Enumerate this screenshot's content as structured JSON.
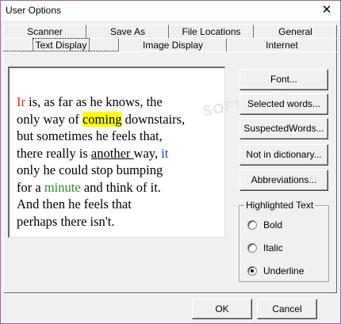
{
  "window": {
    "title": "User Options",
    "close_glyph": "✕"
  },
  "tabs": {
    "back_row": [
      "Scanner",
      "Save As",
      "File Locations",
      "General"
    ],
    "front_row": [
      "Text Display",
      "Image Display",
      "Internet"
    ],
    "active": "Text Display"
  },
  "preview": {
    "lines": [
      [
        {
          "t": "Ir",
          "style": "red"
        },
        {
          "t": " is, as far as he knows, the"
        }
      ],
      [
        {
          "t": "only way of "
        },
        {
          "t": "coming",
          "style": "hl"
        },
        {
          "t": " downstairs,"
        }
      ],
      [
        {
          "t": "but sometimes he feels that,"
        }
      ],
      [
        {
          "t": "there really is "
        },
        {
          "t": "another ",
          "style": "ul"
        },
        {
          "t": "way, "
        },
        {
          "t": "it",
          "style": "blue"
        }
      ],
      [
        {
          "t": "only he could stop bumping"
        }
      ],
      [
        {
          "t": "for a "
        },
        {
          "t": "minute",
          "style": "green"
        },
        {
          "t": " and think of it."
        }
      ],
      [
        {
          "t": "And then he feels that"
        }
      ],
      [
        {
          "t": "perhaps there isn't."
        }
      ]
    ],
    "watermark": "SOFTPEDIA"
  },
  "buttons": {
    "font": "Font...",
    "selected_words": "Selected words...",
    "suspected_words": "SuspectedWords...",
    "not_in_dictionary": "Not in dictionary...",
    "abbreviations": "Abbreviations..."
  },
  "highlighted_text": {
    "label": "Highlighted Text",
    "options": [
      "Bold",
      "Italic",
      "Underline"
    ],
    "selected": "Underline"
  },
  "footer": {
    "ok": "OK",
    "cancel": "Cancel"
  }
}
